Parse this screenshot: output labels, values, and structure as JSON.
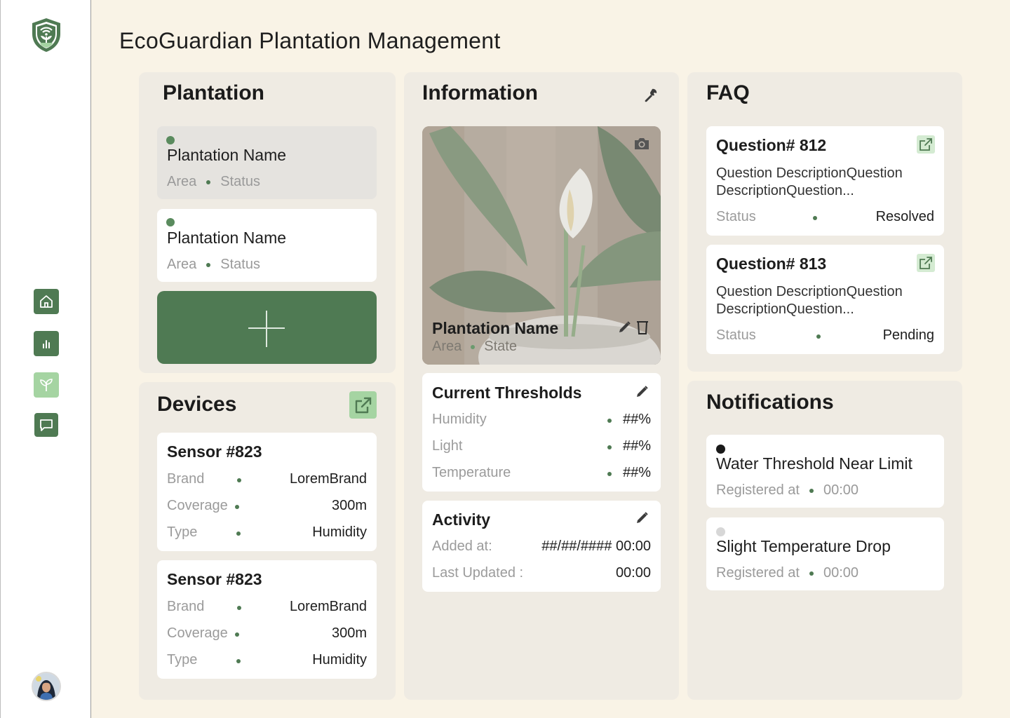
{
  "app": {
    "title": "EcoGuardian Plantation Management"
  },
  "sidebar": {
    "logo_icon": "shield-plant-logo",
    "items": [
      {
        "icon": "home-icon"
      },
      {
        "icon": "chart-icon"
      },
      {
        "icon": "leaf-icon",
        "active": true
      },
      {
        "icon": "message-icon"
      }
    ],
    "avatar": "user-avatar"
  },
  "plantation": {
    "title": "Plantation",
    "items": [
      {
        "name": "Plantation Name",
        "area": "Area",
        "status": "Status",
        "selected": true
      },
      {
        "name": "Plantation Name",
        "area": "Area",
        "status": "Status",
        "selected": false
      }
    ],
    "add_icon": "plus-icon"
  },
  "devices": {
    "title": "Devices",
    "sensors": [
      {
        "title": "Sensor #823",
        "brand_label": "Brand",
        "brand": "LoremBrand",
        "coverage_label": "Coverage",
        "coverage": "300m",
        "type_label": "Type",
        "type": "Humidity"
      },
      {
        "title": "Sensor #823",
        "brand_label": "Brand",
        "brand": "LoremBrand",
        "coverage_label": "Coverage",
        "coverage": "300m",
        "type_label": "Type",
        "type": "Humidity"
      }
    ]
  },
  "information": {
    "title": "Information",
    "photo": {
      "name": "Plantation Name",
      "area": "Area",
      "state": "State"
    },
    "thresholds": {
      "title": "Current Thresholds",
      "rows": [
        {
          "label": "Humidity",
          "value": "##%"
        },
        {
          "label": "Light",
          "value": "##%"
        },
        {
          "label": "Temperature",
          "value": "##%"
        }
      ]
    },
    "activity": {
      "title": "Activity",
      "added_label": "Added at:",
      "added_value": "##/##/#### 00:00",
      "updated_label": "Last Updated :",
      "updated_value": "00:00"
    }
  },
  "faq": {
    "title": "FAQ",
    "questions": [
      {
        "title": "Question# 812",
        "description": "Question DescriptionQuestion DescriptionQuestion...",
        "status_label": "Status",
        "status": "Resolved"
      },
      {
        "title": "Question# 813",
        "description": "Question DescriptionQuestion DescriptionQuestion...",
        "status_label": "Status",
        "status": "Pending"
      }
    ]
  },
  "notifications": {
    "title": "Notifications",
    "items": [
      {
        "title": "Water Threshold Near Limit",
        "label": "Registered at",
        "time": "00:00",
        "unread": true
      },
      {
        "title": "Slight Temperature Drop",
        "label": "Registered at",
        "time": "00:00",
        "unread": false
      }
    ]
  },
  "colors": {
    "accent": "#4f7a53",
    "accent_light": "#a5d4a2",
    "background": "#f9f3e6",
    "panel": "#efebe3"
  }
}
